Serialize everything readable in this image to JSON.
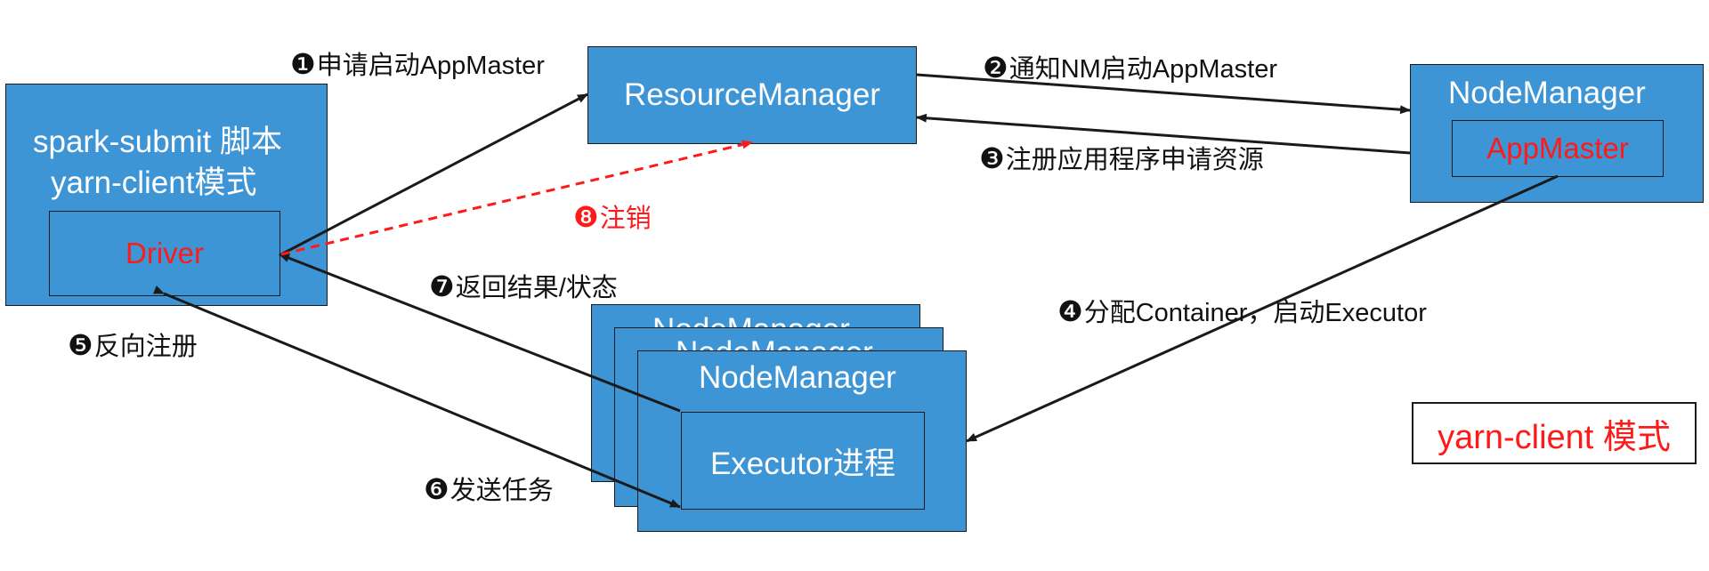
{
  "colors": {
    "box_fill": "#3d95d6",
    "accent_red": "#ff1a1a",
    "line": "#1a1a1a"
  },
  "client": {
    "line1": "spark-submit 脚本",
    "line2": "yarn-client模式",
    "driver": "Driver"
  },
  "resource_manager": {
    "label": "ResourceManager"
  },
  "node_manager_top": {
    "label": "NodeManager",
    "app_master": "AppMaster"
  },
  "worker_nodes": {
    "back_label": "NodeManager",
    "mid_label": "NodeManager",
    "front_label": "NodeManager",
    "executor": "Executor进程"
  },
  "steps": {
    "s1": {
      "num": "❶",
      "text": "申请启动AppMaster"
    },
    "s2": {
      "num": "❷",
      "text": "通知NM启动AppMaster"
    },
    "s3": {
      "num": "❸",
      "text": "注册应用程序申请资源"
    },
    "s4": {
      "num": "❹",
      "text": "分配Container，启动Executor"
    },
    "s5": {
      "num": "❺",
      "text": "反向注册"
    },
    "s6": {
      "num": "❻",
      "text": "发送任务"
    },
    "s7": {
      "num": "❼",
      "text": "返回结果/状态"
    },
    "s8": {
      "num": "❽",
      "text": "注销"
    }
  },
  "mode_tag": "yarn-client 模式"
}
